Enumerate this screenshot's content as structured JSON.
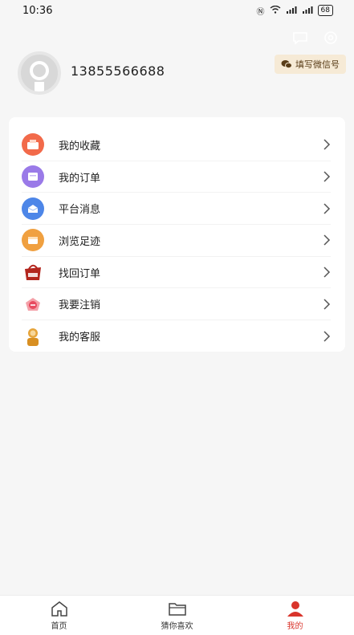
{
  "status": {
    "time": "10:36",
    "battery": "68"
  },
  "profile": {
    "phone": "13855566688",
    "wechat_button": "填写微信号"
  },
  "menu": [
    {
      "label": "我的收藏",
      "icon": "collection-icon",
      "color": "#f26a4a"
    },
    {
      "label": "我的订单",
      "icon": "order-icon",
      "color": "#9a7ae8"
    },
    {
      "label": "平台消息",
      "icon": "message-icon",
      "color": "#4d86e8"
    },
    {
      "label": "浏览足迹",
      "icon": "history-icon",
      "color": "#f0a040"
    },
    {
      "label": "找回订单",
      "icon": "retrieve-order-icon",
      "color": "#b3261e"
    },
    {
      "label": "我要注销",
      "icon": "deregister-icon",
      "color": "#e84a5f"
    },
    {
      "label": "我的客服",
      "icon": "customer-service-icon",
      "color": "#e6a43a"
    }
  ],
  "tabs": [
    {
      "label": "首页",
      "icon": "home-icon"
    },
    {
      "label": "猜你喜欢",
      "icon": "folder-icon"
    },
    {
      "label": "我的",
      "icon": "user-icon"
    }
  ],
  "colors": {
    "accent": "#d9342b",
    "wechat_bg": "#f6ead6"
  }
}
